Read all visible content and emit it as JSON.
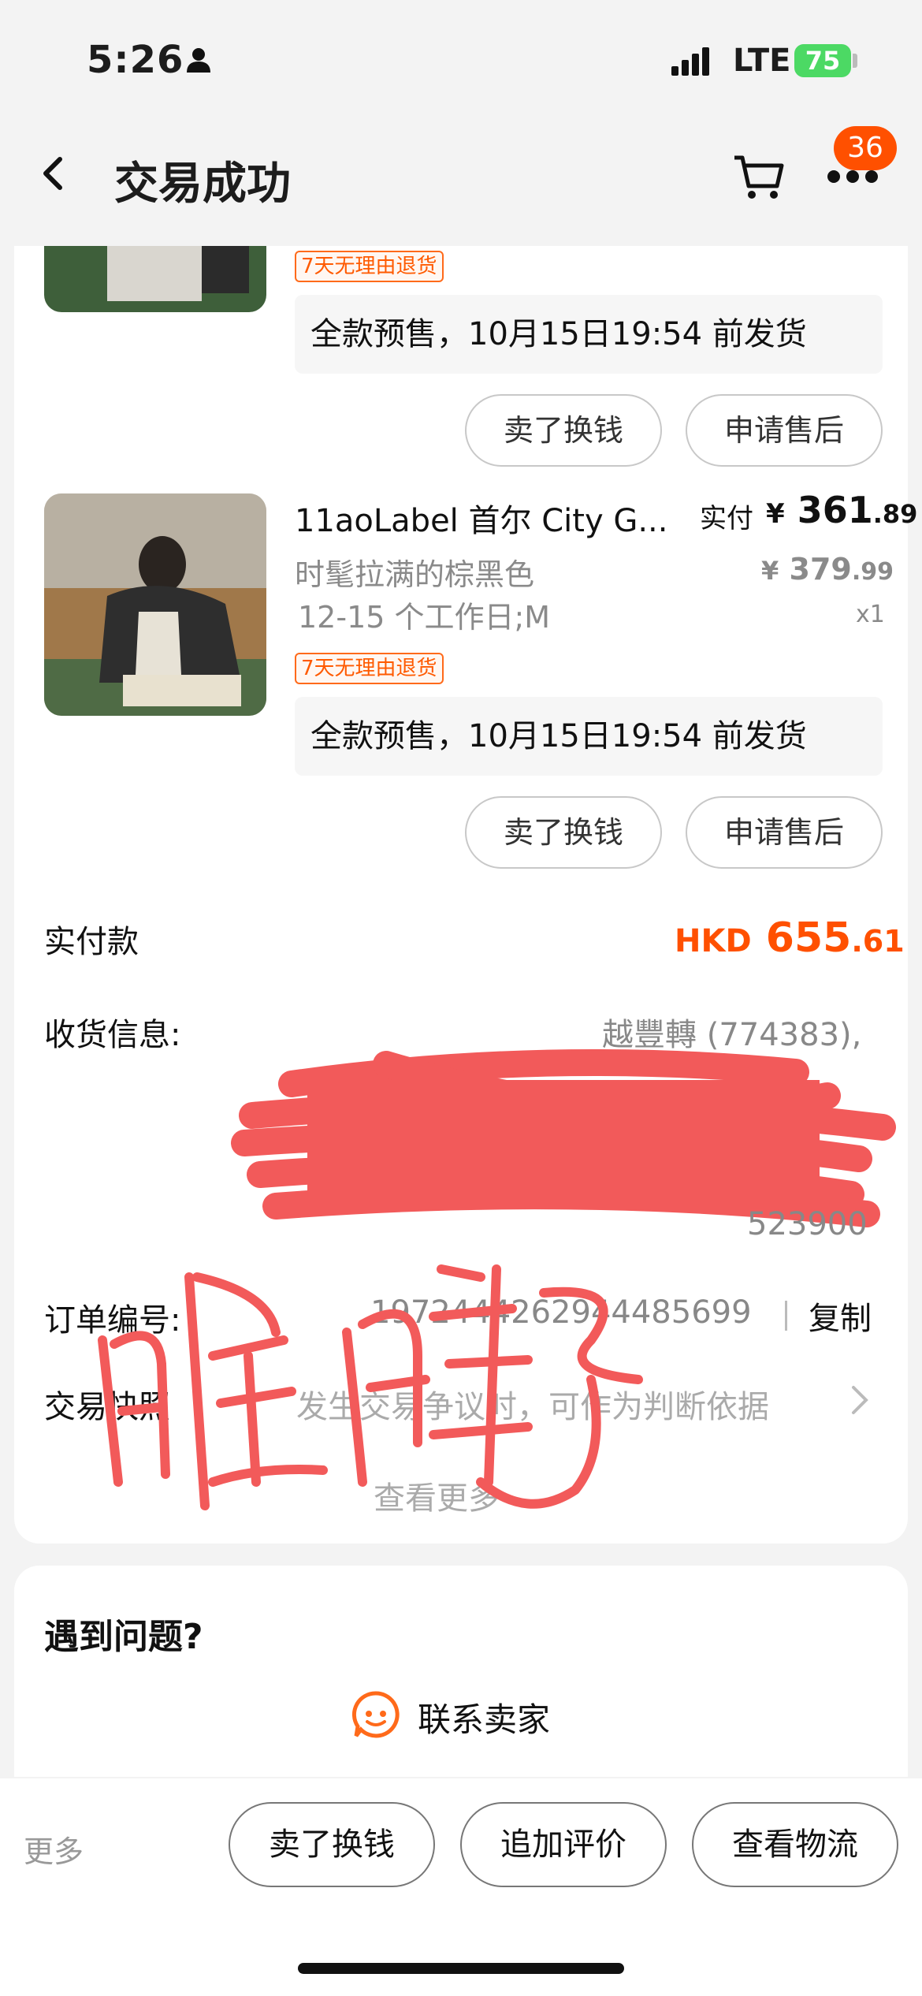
{
  "status": {
    "time": "5:26",
    "network": "LTE",
    "battery": "75"
  },
  "nav": {
    "title": "交易成功",
    "badge": "36"
  },
  "items": [
    {
      "return_tag": "7天无理由退货",
      "presale": "全款预售，10月15日19:54 前发货",
      "btn_sell": "卖了换钱",
      "btn_aftersale": "申请售后"
    },
    {
      "title": "11aoLabel 首尔 City G...",
      "color": "时髦拉满的棕黑色",
      "spec": "12-15 个工作日;M",
      "paid_label": "实付",
      "paid_currency": "¥",
      "paid_int": "361",
      "paid_dec": ".89",
      "orig_currency": "¥",
      "orig_int": "379",
      "orig_dec": ".99",
      "qty": "x1",
      "return_tag": "7天无理由退货",
      "presale": "全款预售，10月15日19:54 前发货",
      "btn_sell": "卖了换钱",
      "btn_aftersale": "申请售后"
    }
  ],
  "summary": {
    "total_label": "实付款",
    "total_currency": "HKD",
    "total_int": "655",
    "total_dec": ".61",
    "address_label": "收货信息:",
    "address_name": "越豐轉 (774383),",
    "address_zip": "523900",
    "order_label": "订单编号:",
    "order_number": "1972444262944485699",
    "copy": "复制",
    "snapshot_label": "交易快照",
    "snapshot_desc": "发生交易争议时，可作为判断依据",
    "see_more": "查看更多"
  },
  "problem": {
    "title": "遇到问题?",
    "contact": "联系卖家"
  },
  "bottom": {
    "more": "更多",
    "btn1": "卖了换钱",
    "btn2": "追加评价",
    "btn3": "查看物流"
  },
  "colors": {
    "accent": "#ff5000",
    "redaction": "#f25a5a"
  }
}
